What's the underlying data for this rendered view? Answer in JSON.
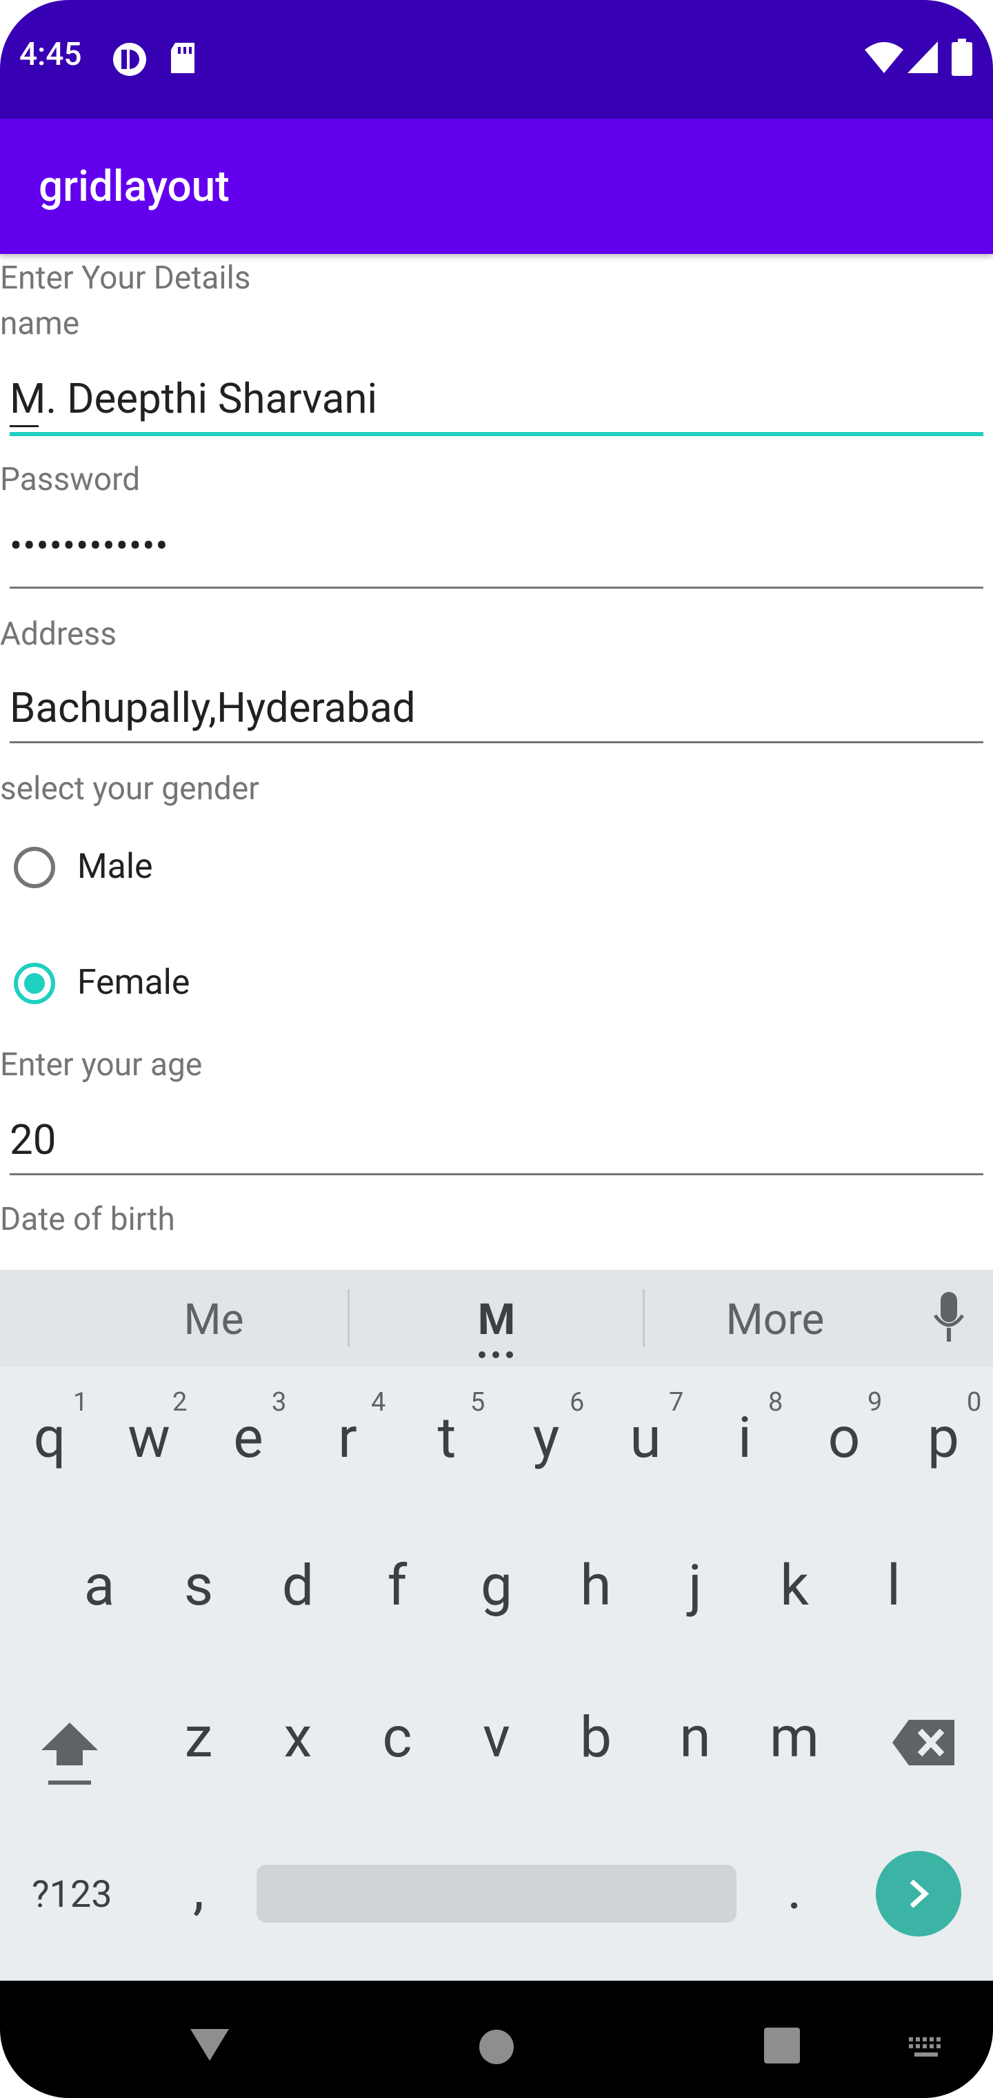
{
  "status_bar": {
    "time": "4:45"
  },
  "app_bar": {
    "title": "gridlayout"
  },
  "form": {
    "heading": "Enter Your Details",
    "name_label": "name",
    "name_value": "M. Deepthi Sharvani",
    "password_label": "Password",
    "password_value": "••••••••••••",
    "address_label": "Address",
    "address_value": "Bachupally,Hyderabad",
    "gender_label": "select your gender",
    "gender_options": [
      "Male",
      "Female"
    ],
    "gender_selected": "Female",
    "age_label": "Enter your age",
    "age_value": "20",
    "dob_label": "Date of birth"
  },
  "keyboard": {
    "suggestions": [
      "Me",
      "M",
      "More"
    ],
    "row1": [
      "q",
      "w",
      "e",
      "r",
      "t",
      "y",
      "u",
      "i",
      "o",
      "p"
    ],
    "row1_hints": [
      "1",
      "2",
      "3",
      "4",
      "5",
      "6",
      "7",
      "8",
      "9",
      "0"
    ],
    "row2": [
      "a",
      "s",
      "d",
      "f",
      "g",
      "h",
      "j",
      "k",
      "l"
    ],
    "row3": [
      "z",
      "x",
      "c",
      "v",
      "b",
      "n",
      "m"
    ],
    "symbols_label": "?123",
    "comma": ",",
    "period": "."
  },
  "colors": {
    "status_bar": "#3700b3",
    "app_bar": "#6200ee",
    "accent": "#1fcfc0",
    "enter_key": "#3bb3a5"
  }
}
